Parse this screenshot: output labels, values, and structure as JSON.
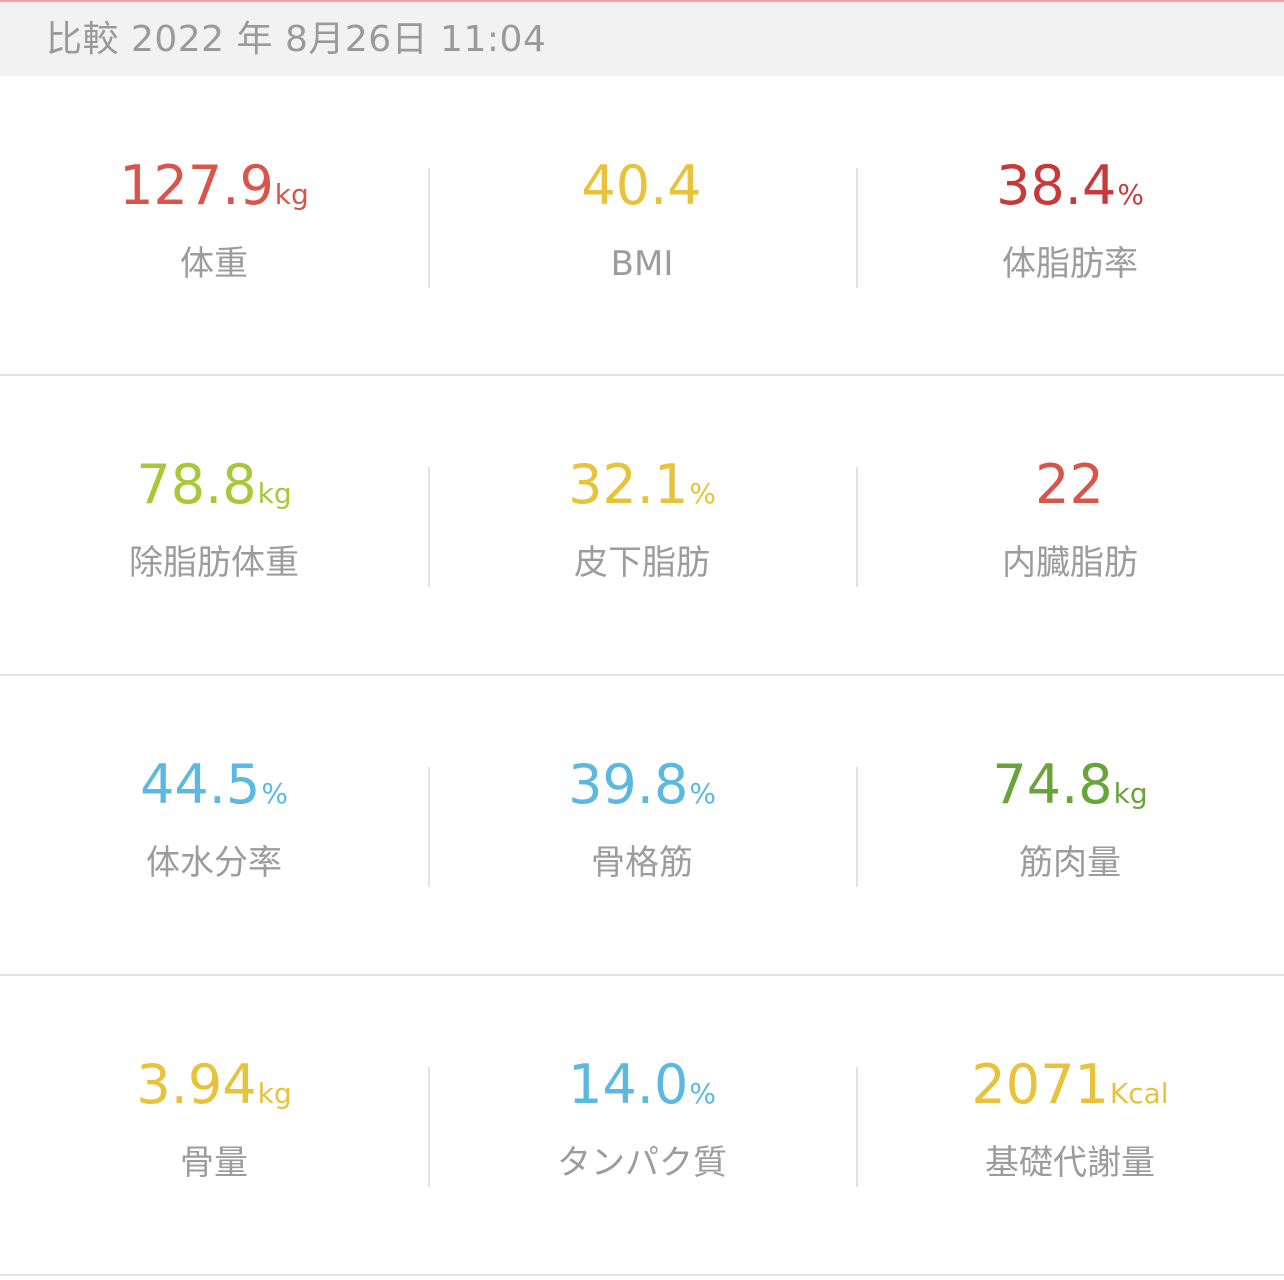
{
  "header": {
    "title": "比較 2022 年 8月26日 11:04"
  },
  "metrics": [
    {
      "value": "127.9",
      "unit": "kg",
      "label": "体重",
      "color": "#d9544a"
    },
    {
      "value": "40.4",
      "unit": "",
      "label": "BMI",
      "color": "#e8c23a"
    },
    {
      "value": "38.4",
      "unit": "%",
      "label": "体脂肪率",
      "color": "#c63a3a"
    },
    {
      "value": "78.8",
      "unit": "kg",
      "label": "除脂肪体重",
      "color": "#a8c83a"
    },
    {
      "value": "32.1",
      "unit": "%",
      "label": "皮下脂肪",
      "color": "#e8c23a"
    },
    {
      "value": "22",
      "unit": "",
      "label": "内臓脂肪",
      "color": "#d9544a"
    },
    {
      "value": "44.5",
      "unit": "%",
      "label": "体水分率",
      "color": "#5bb8e0"
    },
    {
      "value": "39.8",
      "unit": "%",
      "label": "骨格筋",
      "color": "#5bb8e0"
    },
    {
      "value": "74.8",
      "unit": "kg",
      "label": "筋肉量",
      "color": "#6aa33a"
    },
    {
      "value": "3.94",
      "unit": "kg",
      "label": "骨量",
      "color": "#e8c23a"
    },
    {
      "value": "14.0",
      "unit": "%",
      "label": "タンパク質",
      "color": "#5bb8e0"
    },
    {
      "value": "2071",
      "unit": "Kcal",
      "label": "基礎代謝量",
      "color": "#e8c23a"
    }
  ]
}
